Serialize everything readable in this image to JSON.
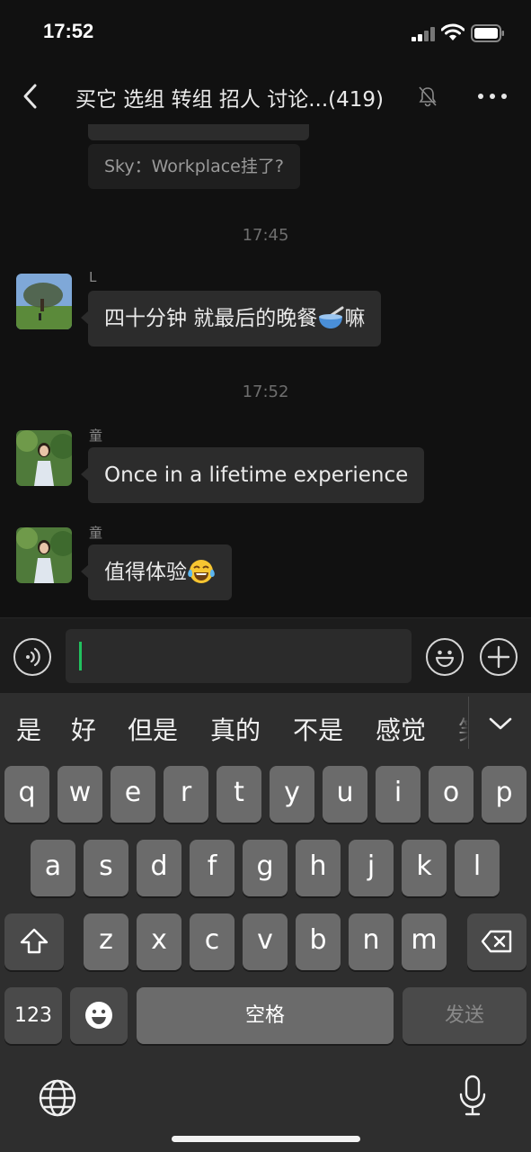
{
  "status_bar": {
    "time": "17:52",
    "icons": [
      "cellular-signal-icon",
      "wifi-icon",
      "battery-icon"
    ]
  },
  "header": {
    "title": "买它 选组 转组 招人 讨论...(419)",
    "icons": [
      "back-icon",
      "mute-bell-icon",
      "more-icon"
    ]
  },
  "chat": {
    "system_message": "Sky：Workplace挂了?",
    "timestamps": [
      "17:45",
      "17:52"
    ],
    "messages": [
      {
        "sender": "L",
        "text": "四十分钟 就最后的晚餐",
        "text_after": "嘛",
        "emoji": "bowl-with-spoon-emoji"
      },
      {
        "sender": "童",
        "text": "Once in a lifetime experience"
      },
      {
        "sender": "童",
        "text": "值得体验",
        "emoji": "tears-of-joy-emoji"
      }
    ]
  },
  "input_bar": {
    "value": "",
    "icons": [
      "voice-icon",
      "emoji-icon",
      "plus-icon"
    ]
  },
  "keyboard": {
    "suggestions": [
      "是",
      "好",
      "但是",
      "真的",
      "不是",
      "感觉",
      "笑"
    ],
    "row1": [
      "q",
      "w",
      "e",
      "r",
      "t",
      "y",
      "u",
      "i",
      "o",
      "p"
    ],
    "row2": [
      "a",
      "s",
      "d",
      "f",
      "g",
      "h",
      "j",
      "k",
      "l"
    ],
    "row3": [
      "z",
      "x",
      "c",
      "v",
      "b",
      "n",
      "m"
    ],
    "numbers_key": "123",
    "space_key": "空格",
    "send_key": "发送"
  },
  "colors": {
    "accent_caret": "#21c15e",
    "bubble": "#2c2c2c",
    "background": "#111111"
  }
}
